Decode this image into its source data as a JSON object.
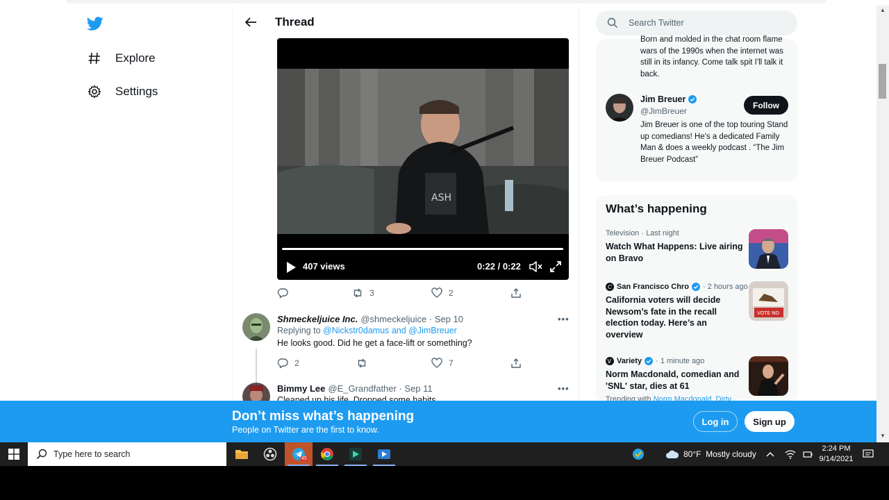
{
  "left_nav": {
    "items": [
      {
        "label": "Explore"
      },
      {
        "label": "Settings"
      }
    ]
  },
  "thread": {
    "title": "Thread",
    "video": {
      "views": "407 views",
      "time": "0:22 / 0:22",
      "progress": 1.0
    },
    "tweet_actions": {
      "replies": "",
      "retweets": "3",
      "likes": "2"
    },
    "replies": [
      {
        "name": "Shmeckeljuice Inc.",
        "meta": "@shmeckeljuice · Sep 10",
        "replying_prefix": "Replying to",
        "replying_to": "@Nickstr0damus and @JimBreuer",
        "text": "He looks good. Did he get a face-lift or something?",
        "replies": "2",
        "retweets": "",
        "likes": "7"
      },
      {
        "name": "Bimmy Lee",
        "meta": "@E_Grandfather · Sep 11",
        "text": "Cleaned up his life. Dropped some habits..."
      }
    ]
  },
  "search": {
    "placeholder": "Search Twitter"
  },
  "bio_top": "Born and molded in the chat room flame wars of the 1990s when the internet was still in its infancy. Come talk spit I'll talk it back.",
  "who_to_follow": {
    "name": "Jim Breuer",
    "handle": "@JimBreuer",
    "follow_label": "Follow",
    "bio": "Jim Breuer is one of the top touring Stand up comedians! He's a dedicated Family Man & does a weekly podcast . “The Jim Breuer Podcast”"
  },
  "whats_happening": {
    "title": "What’s happening",
    "trends": [
      {
        "context": "Television · Last night",
        "source": "",
        "time": "",
        "headline": "Watch What Happens: Live airing on Bravo"
      },
      {
        "context": "",
        "source": "San Francisco Chro",
        "time": "· 2 hours ago",
        "headline": "California voters will decide Newsom’s fate in the recall election today. Here’s an overview"
      },
      {
        "context": "",
        "source": "Variety",
        "time": "· 1 minute ago",
        "headline": "Norm Macdonald, comedian and 'SNL' star, dies at 61"
      }
    ],
    "trending_with_prefix": "Trending with",
    "trending_with": "Norm Macdonald, Dirty"
  },
  "banner": {
    "title": "Don’t miss what’s happening",
    "subtitle": "People on Twitter are the first to know.",
    "login_label": "Log in",
    "signup_label": "Sign up"
  },
  "taskbar": {
    "search_placeholder": "Type here to search",
    "weather": "80°F  Mostly cloudy",
    "time": "2:24 PM",
    "date": "9/14/2021",
    "badge": "45"
  },
  "colors": {
    "twitter_blue": "#1d9bf0",
    "text": "#0f1419",
    "muted": "#536471"
  }
}
